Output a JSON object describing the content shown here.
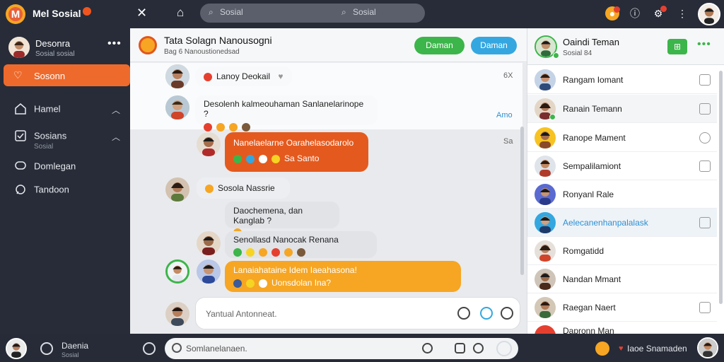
{
  "app": {
    "title": "Mel Sosial",
    "logo_letter": "M"
  },
  "search": {
    "placeholder_left": "Sosial",
    "placeholder_right": "Sosial"
  },
  "sidebar": {
    "profile_name": "Desonra",
    "profile_sub": "Sosial sosial",
    "items": [
      {
        "label": "Sosonn",
        "active": true
      },
      {
        "label": "Hamel"
      },
      {
        "label": "Sosians",
        "sub": "Sosial"
      },
      {
        "label": "Domlegan"
      },
      {
        "label": "Tandoon"
      }
    ]
  },
  "chat": {
    "title": "Tata Solagn Nanousogni",
    "subtitle": "Bag 6 Nanoustionedsad",
    "btn_green": "Daman",
    "btn_blue": "Daman",
    "messages": [
      {
        "text": "Lanoy Deokail",
        "meta": "6X"
      },
      {
        "text": "Desolenh kalmeouhaman Sanlanelarinope ?",
        "meta": "Amo"
      },
      {
        "text": "Nanelaelarne Oarahelasodarolo",
        "sub": "Sa Santo",
        "meta": "Sa"
      },
      {
        "text": "Sosola Nassrie"
      },
      {
        "text": "Daochemena, dan Kanglab ?"
      },
      {
        "text": "Senollasd Nanocak Renana"
      },
      {
        "text": "Lanaiahataine Idem Iaeahasona!",
        "sub": "Uonsdolan Ina?"
      }
    ],
    "input_placeholder": "Yantual Antonneat."
  },
  "right": {
    "header_name": "Oaindi Teman",
    "header_sub": "Sosial 84",
    "contacts": [
      {
        "name": "Rangam Iomant"
      },
      {
        "name": "Ranain Temann"
      },
      {
        "name": "Ranope Mament"
      },
      {
        "name": "Sempalilamiont"
      },
      {
        "name": "Ronyanl Rale"
      },
      {
        "name": "Aelecanenhanpalalask"
      },
      {
        "name": "Romgatidd"
      },
      {
        "name": "Nandan Mmant"
      },
      {
        "name": "Raegan Naert"
      },
      {
        "name": "Dapronn Man"
      }
    ]
  },
  "bottom": {
    "name": "Daenia",
    "sub": "Sosial",
    "compose_placeholder": "Somlanelanaen.",
    "status": "Iaoe Snamaden"
  },
  "colors": {
    "accent": "#ee6a2c",
    "green": "#3cb54a",
    "blue": "#34a7e0",
    "orange": "#f6a623"
  }
}
